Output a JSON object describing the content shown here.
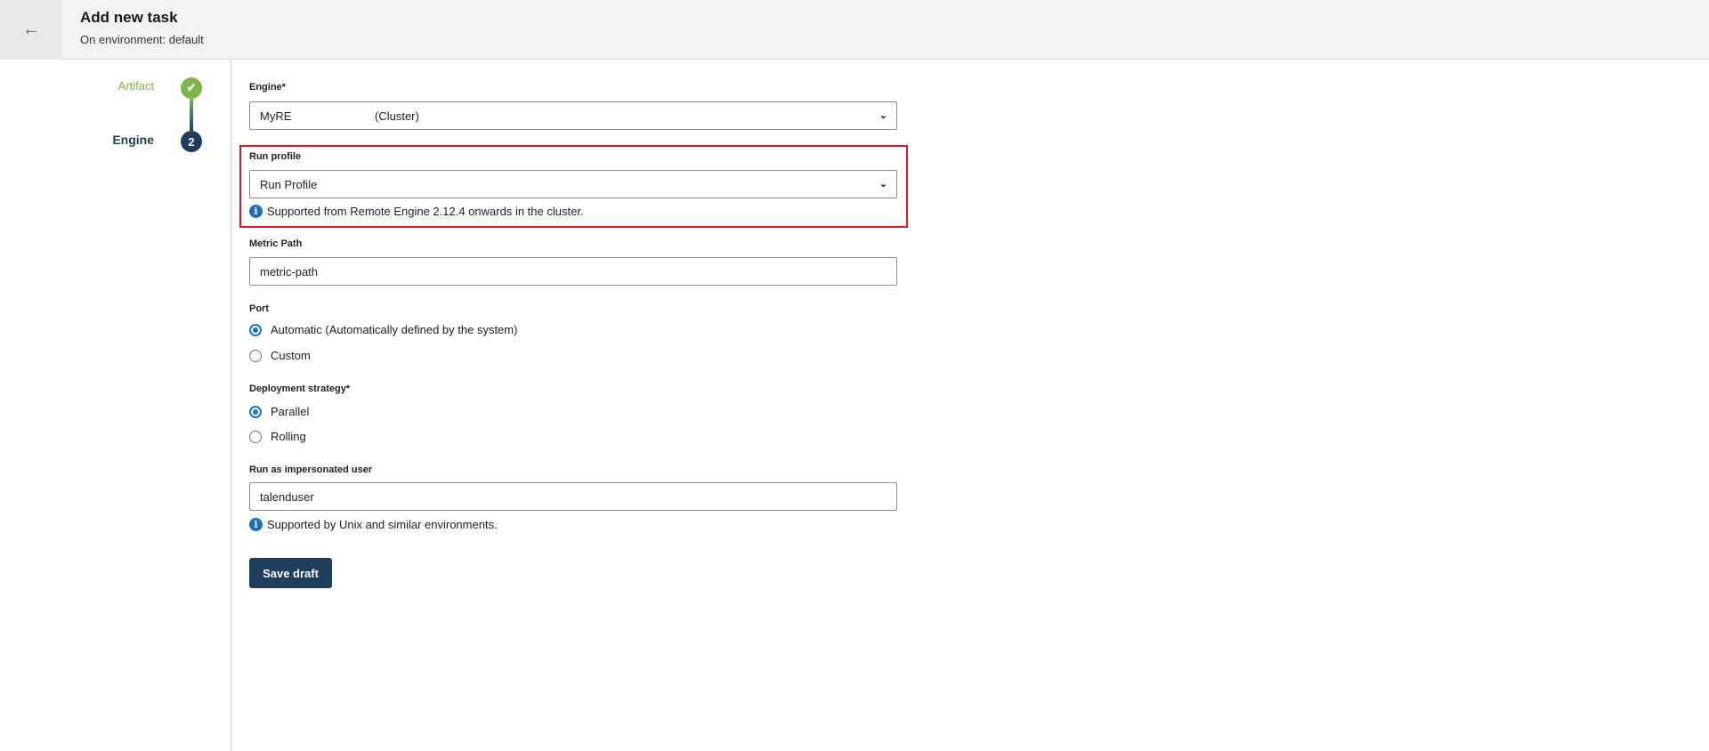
{
  "header": {
    "title": "Add new task",
    "subtitle": "On environment: default",
    "back_icon": "arrow-left-icon"
  },
  "stepper": {
    "steps": [
      {
        "label": "Artifact",
        "state": "done",
        "color": "#7ab648"
      },
      {
        "label": "Engine",
        "number": "2",
        "state": "current",
        "color": "#1f3d5c"
      }
    ]
  },
  "form": {
    "engine": {
      "label": "Engine*",
      "name": "MyRE",
      "type": "(Cluster)"
    },
    "run_profile": {
      "label": "Run profile",
      "value": "Run Profile",
      "info": "Supported from Remote Engine 2.12.4 onwards in the cluster.",
      "highlight_color": "#e5141f"
    },
    "metric_path": {
      "label": "Metric Path",
      "value": "metric-path"
    },
    "port": {
      "label": "Port",
      "options": [
        "Automatic (Automatically defined by the system)",
        "Custom"
      ],
      "selected": 0
    },
    "deployment": {
      "label": "Deployment strategy*",
      "options": [
        "Parallel",
        "Rolling"
      ],
      "selected": 0
    },
    "impersonated": {
      "label": "Run as impersonated user",
      "value": "talenduser",
      "info": "Supported by Unix and similar environments."
    },
    "save_label": "Save draft"
  }
}
